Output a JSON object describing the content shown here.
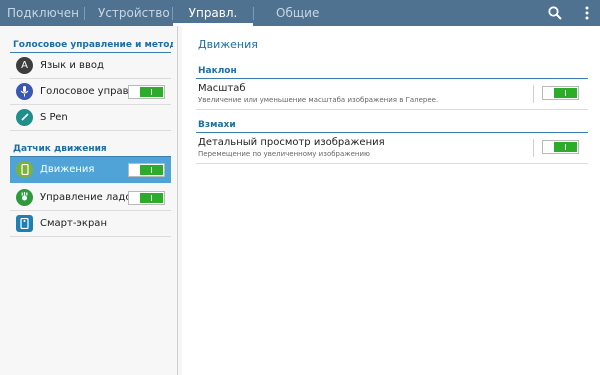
{
  "tabs": [
    "Подключения",
    "Устройство",
    "Управл.",
    "Общие"
  ],
  "toolbar": {
    "search_icon": "search-icon",
    "more_icon": "more-vertical-icon"
  },
  "sidebar": {
    "section1": "Голосовое управление и методы в...",
    "section2": "Датчик движения",
    "items": [
      {
        "label": "Язык и ввод",
        "icon": "keyboard-letter-icon",
        "color": "#3d3d3d",
        "toggle": null
      },
      {
        "label": "Голосовое управление",
        "icon": "microphone-icon",
        "color": "#3b57b5",
        "toggle": true
      },
      {
        "label": "S Pen",
        "icon": "pen-icon",
        "color": "#1f8f8a",
        "toggle": null
      },
      {
        "label": "Движения",
        "icon": "motion-icon",
        "color": "#7bb33a",
        "toggle": true,
        "selected": true
      },
      {
        "label": "Управление ладонью",
        "icon": "palm-icon",
        "color": "#2d9a3e",
        "toggle": true
      },
      {
        "label": "Смарт-экран",
        "icon": "smart-screen-icon",
        "color": "#1f7fb3",
        "toggle": null
      }
    ]
  },
  "main": {
    "title": "Движения",
    "categories": [
      {
        "label": "Наклон",
        "rows": [
          {
            "title": "Масштаб",
            "subtitle": "Увеличение или уменьшение масштаба изображения в Галерее.",
            "enabled": true
          }
        ]
      },
      {
        "label": "Взмахи",
        "rows": [
          {
            "title": "Детальный просмотр изображения",
            "subtitle": "Перемещение по увеличенному изображению",
            "enabled": true
          }
        ]
      }
    ]
  },
  "colors": {
    "topbar": "#4e7290",
    "accent": "#1c6fa6",
    "selected": "#4fa3d6",
    "switch_on": "#2cad2a"
  }
}
